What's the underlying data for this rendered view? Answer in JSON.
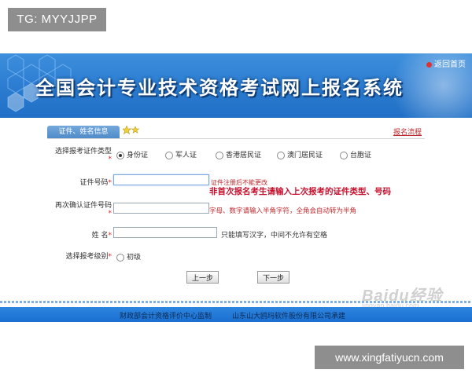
{
  "watermark_top": "TG: MYYJJPP",
  "watermark_bottom": "www.xingfatiyucn.com",
  "banner": {
    "title": "全国会计专业技术资格考试网上报名系统",
    "home_link": "返回首页"
  },
  "tabs": {
    "active_label": "证件、姓名信息",
    "flow_link": "报名流程"
  },
  "form": {
    "id_type_label": "选择报考证件类型",
    "required_mark": "*",
    "id_types": [
      "身份证",
      "军人证",
      "香港居民证",
      "澳门居民证",
      "台胞证"
    ],
    "selected_id_type": "身份证",
    "id_number_label": "证件号码",
    "id_number_value": "",
    "id_number_note": "证件注册后不能更改",
    "repeat_notice": "非首次报名考生请输入上次报考的证件类型、号码",
    "confirm_id_label": "再次确认证件号码",
    "confirm_id_value": "",
    "charset_note": "字母、数字请输入半角字符，全角会自动转为半角",
    "name_label": "姓 名",
    "name_value": "",
    "name_note": "只能填写汉字，中间不允许有空格",
    "level_label": "选择报考级别",
    "levels": [
      "初级"
    ],
    "prev_button": "上一步",
    "next_button": "下一步"
  },
  "footer": {
    "supervisor": "财政部会计资格评价中心监制",
    "developer": "山东山大鸥玛软件股份有限公司承建"
  },
  "baidu_watermark": {
    "logo": "Baidu经验",
    "url": "jingyan.baidu.com"
  },
  "colors": {
    "banner_blue": "#2e7fd3",
    "tab_blue": "#5b95d0",
    "alert_red": "#c8102e",
    "footer_blue": "#1f78d6"
  }
}
